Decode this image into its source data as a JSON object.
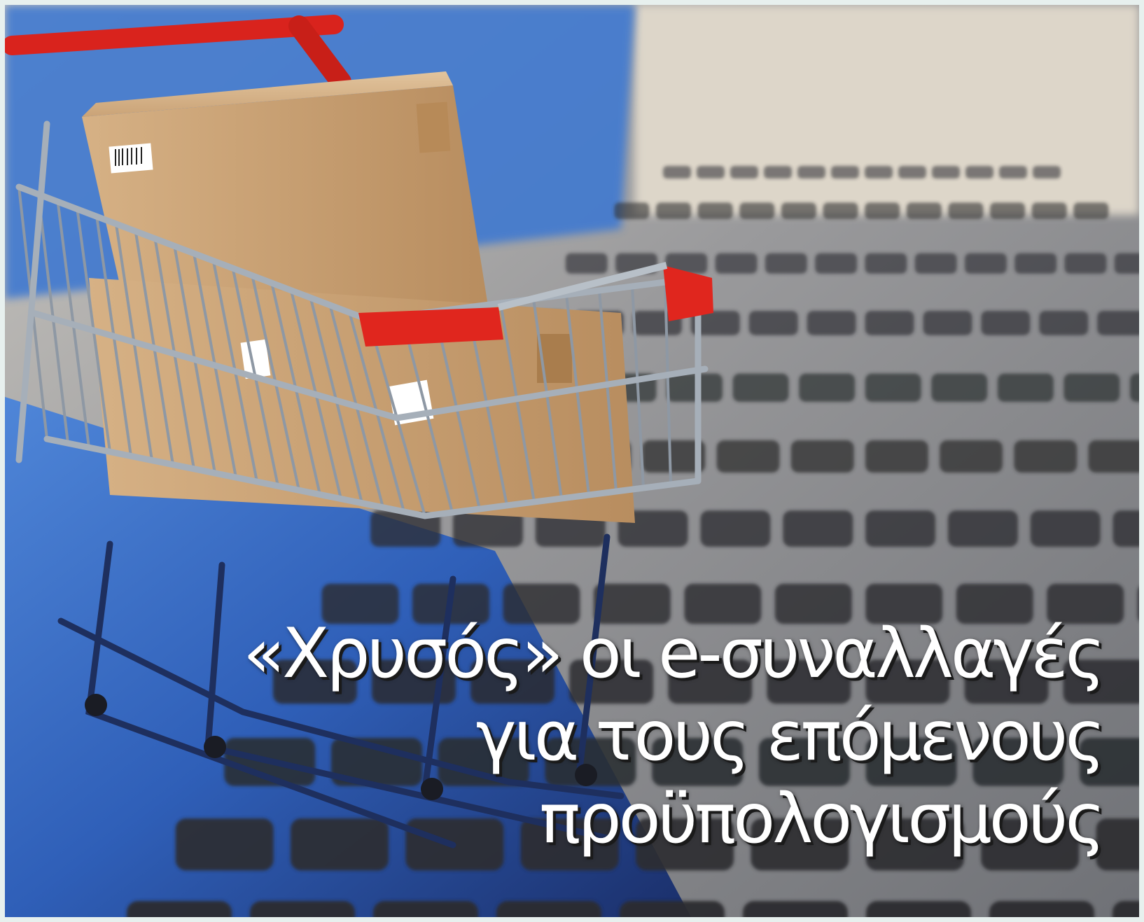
{
  "headline": {
    "line1": "«Χρυσός» οι e-συναλλαγές",
    "line2": "για τους επόμενους",
    "line3": "προϋπολογισμούς"
  },
  "photo": {
    "subject": "shopping-cart-with-boxes-on-laptop-keyboard",
    "colors": {
      "background_keyboard": "#8f9093",
      "keys": "#2b2c30",
      "blue_light": "#3566c4",
      "cart_handle_red": "#e0261e",
      "cardboard": "#c9a277",
      "metal": "#9aa3ad"
    }
  }
}
